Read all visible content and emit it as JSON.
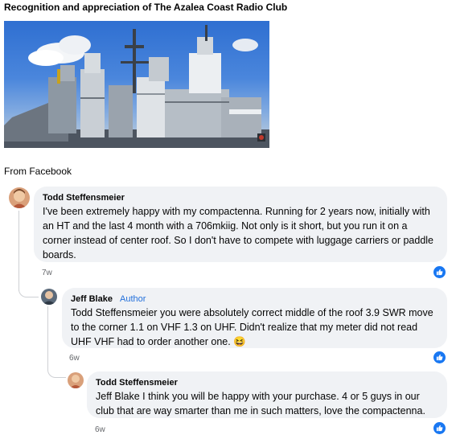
{
  "page": {
    "title": "Recognition and appreciation of The Azalea Coast Radio Club",
    "source_label": "From Facebook"
  },
  "photo": {
    "subject": "battleship superstructure under blue sky"
  },
  "comments": [
    {
      "author": "Todd Steffensmeier",
      "text": "I've been extremely happy with my compactenna. Running for 2 years now, initially with an HT and the last 4 month with a 706mkiig. Not only is it short, but you run it on a corner instead of center roof. So I don't have to compete with luggage carriers or paddle boards.",
      "time": "7w",
      "reaction_icon": "like-icon"
    },
    {
      "author": "Jeff Blake",
      "badge": "Author",
      "text": "Todd Steffensmeier you were absolutely correct middle of the roof 3.9 SWR move to the corner 1.1 on VHF 1.3 on UHF. Didn't realize that my meter did not read UHF VHF had to order another one. 😆",
      "time": "6w",
      "reaction_icon": "like-icon"
    },
    {
      "author": "Todd Steffensmeier",
      "text": "Jeff Blake I think you will be happy with your purchase. 4 or 5 guys in our club that are way smarter than me in such matters, love the compactenna.",
      "time": "6w",
      "reaction_icon": "like-icon"
    }
  ],
  "colors": {
    "bubble": "#f0f2f5",
    "accent": "#1877f2",
    "author_badge": "#216fdb",
    "muted": "#65676b"
  }
}
